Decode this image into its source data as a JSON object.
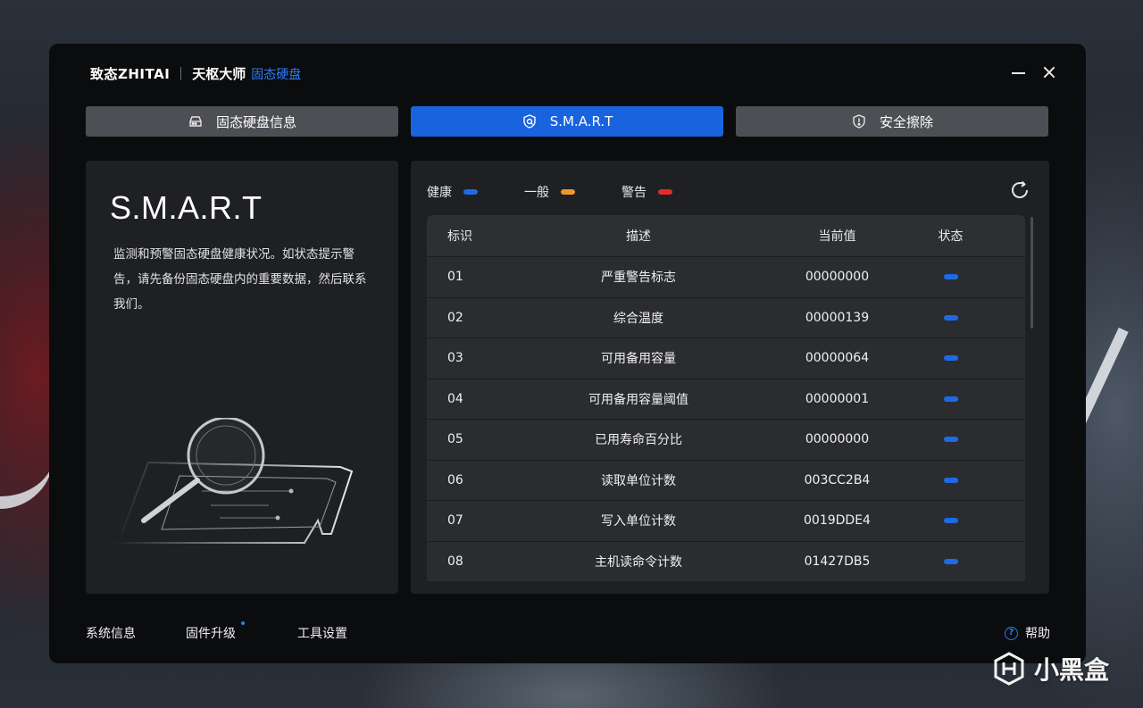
{
  "window": {
    "brand_logo": "致态ZHITAI",
    "brand_name": "天枢大师",
    "brand_accent": "固态硬盘"
  },
  "tabs": [
    {
      "label": "固态硬盘信息",
      "icon": "drive-icon",
      "active": false
    },
    {
      "label": "S.M.A.R.T",
      "icon": "shield-icon",
      "active": true
    },
    {
      "label": "安全擦除",
      "icon": "warning-shield-icon",
      "active": false
    }
  ],
  "left_panel": {
    "title": "S.M.A.R.T",
    "description": "监测和预警固态硬盘健康状况。如状态提示警告，请先备份固态硬盘内的重要数据，然后联系我们。"
  },
  "legend": [
    {
      "label": "健康",
      "color": "#1e6ae6"
    },
    {
      "label": "一般",
      "color": "#f0962e"
    },
    {
      "label": "警告",
      "color": "#e32b2b"
    }
  ],
  "table": {
    "headers": [
      "标识",
      "描述",
      "当前值",
      "状态"
    ],
    "rows": [
      {
        "id": "01",
        "desc": "严重警告标志",
        "value": "00000000",
        "status": "健康"
      },
      {
        "id": "02",
        "desc": "综合温度",
        "value": "00000139",
        "status": "健康"
      },
      {
        "id": "03",
        "desc": "可用备用容量",
        "value": "00000064",
        "status": "健康"
      },
      {
        "id": "04",
        "desc": "可用备用容量阈值",
        "value": "00000001",
        "status": "健康"
      },
      {
        "id": "05",
        "desc": "已用寿命百分比",
        "value": "00000000",
        "status": "健康"
      },
      {
        "id": "06",
        "desc": "读取单位计数",
        "value": "003CC2B4",
        "status": "健康"
      },
      {
        "id": "07",
        "desc": "写入单位计数",
        "value": "0019DDE4",
        "status": "健康"
      },
      {
        "id": "08",
        "desc": "主机读命令计数",
        "value": "01427DB5",
        "status": "健康"
      }
    ]
  },
  "footer": {
    "system_info": "系统信息",
    "firmware_upgrade": "固件升级",
    "tool_settings": "工具设置",
    "help": "帮助"
  },
  "watermark": "小黑盒",
  "colors": {
    "accent": "#1a63df",
    "healthy": "#1e6ae6",
    "normal": "#f0962e",
    "warning": "#e32b2b"
  }
}
